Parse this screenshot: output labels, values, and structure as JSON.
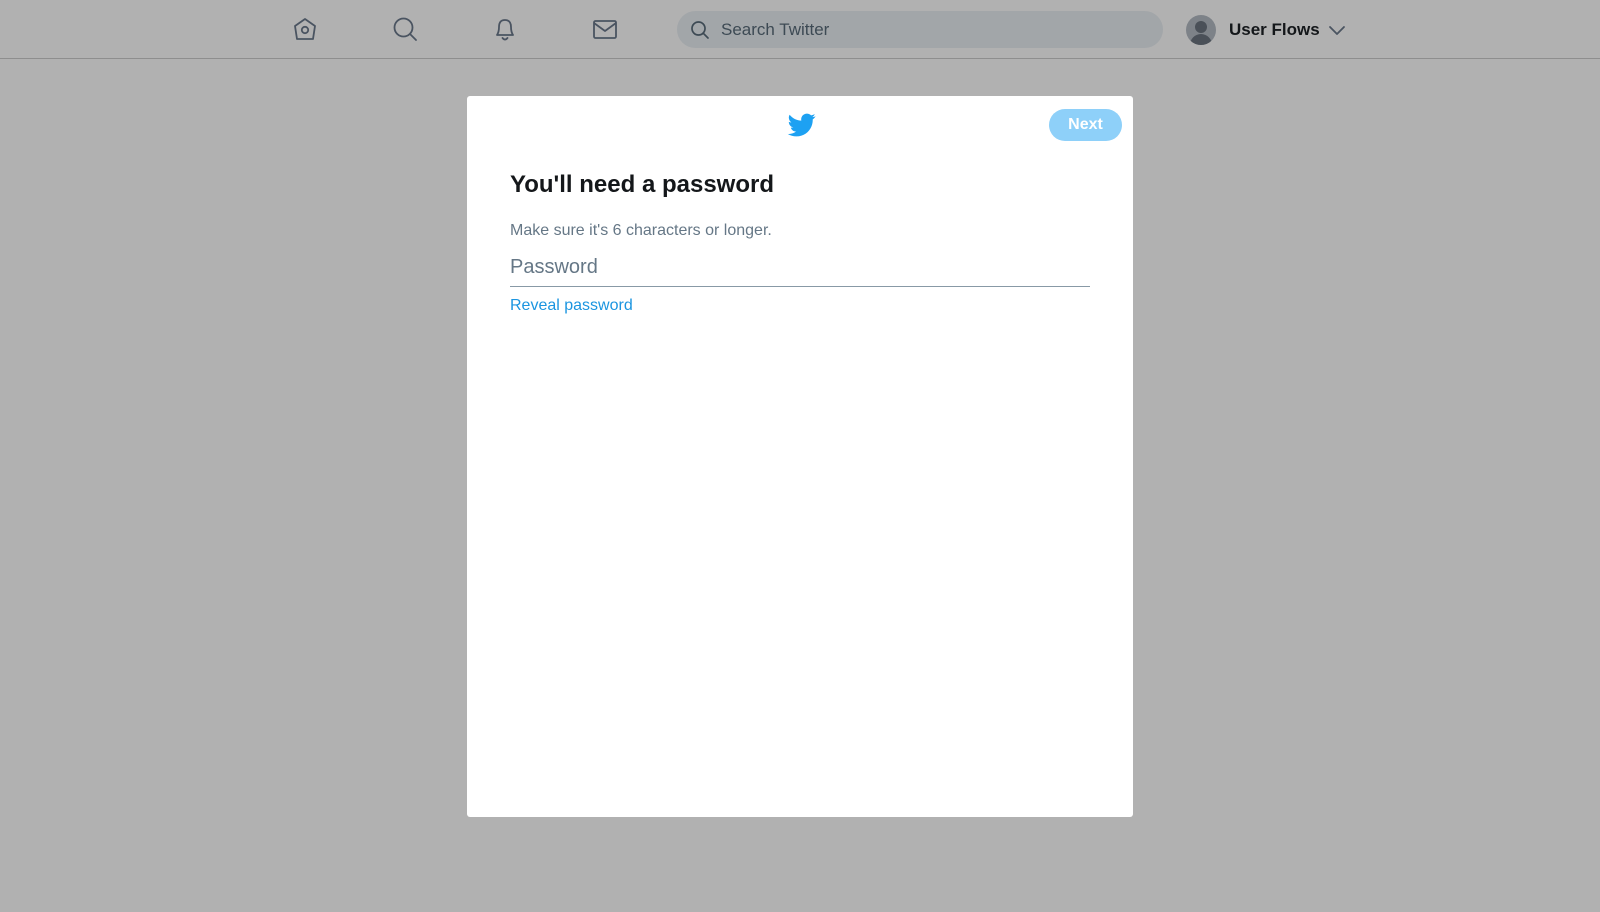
{
  "topbar": {
    "nav": [
      {
        "name": "home",
        "icon": "home-icon"
      },
      {
        "name": "explore",
        "icon": "search-icon"
      },
      {
        "name": "notifications",
        "icon": "bell-icon"
      },
      {
        "name": "messages",
        "icon": "mail-icon"
      }
    ],
    "search": {
      "placeholder": "Search Twitter",
      "value": ""
    },
    "account": {
      "name": "User Flows",
      "avatar_icon": "default-avatar-icon",
      "chevron_icon": "chevron-down-icon"
    }
  },
  "modal": {
    "logo_icon": "twitter-bird-icon",
    "next_label": "Next",
    "title": "You'll need a password",
    "hint": "Make sure it's 6 characters or longer.",
    "password": {
      "placeholder": "Password",
      "value": ""
    },
    "reveal_label": "Reveal password"
  },
  "colors": {
    "overlay_background": "#b1b1b1",
    "brand_blue": "#1da1f2",
    "next_button_disabled": "#8ed0f9",
    "link_blue": "#1b95e0",
    "text_primary": "#14171a",
    "text_secondary": "#657786"
  }
}
